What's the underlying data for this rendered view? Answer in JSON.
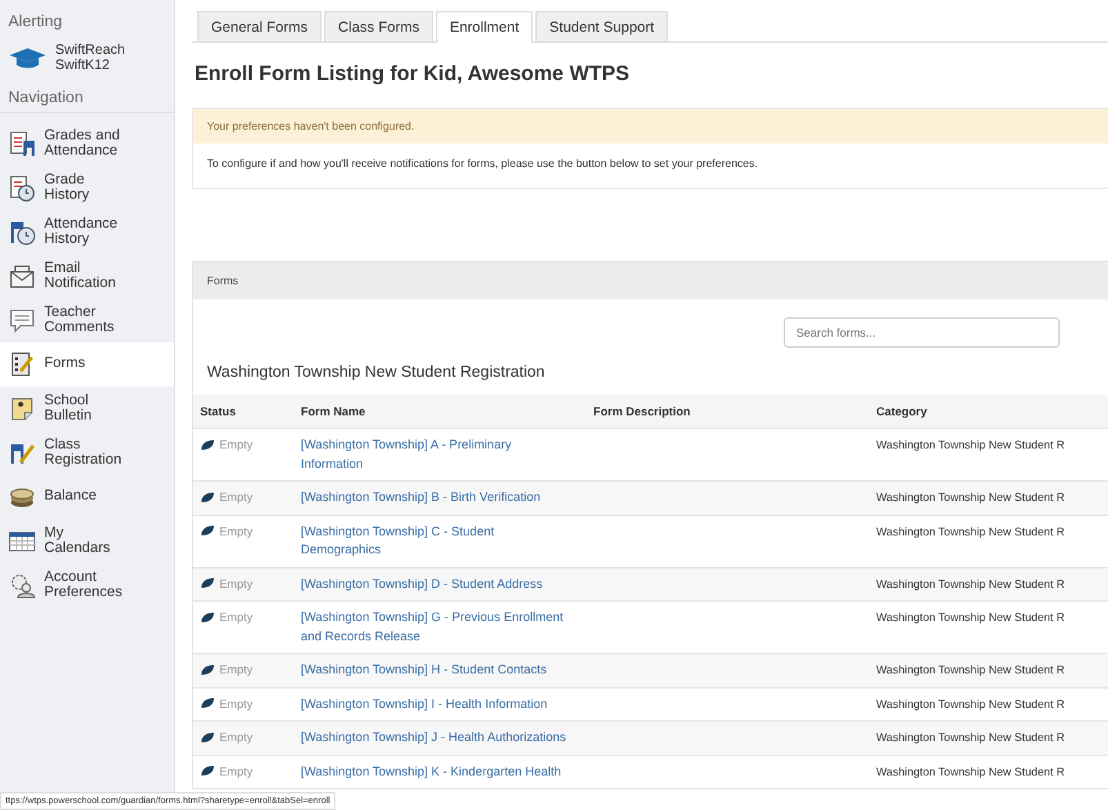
{
  "sidebar": {
    "alerting_heading": "Alerting",
    "alert_app": {
      "label": "SwiftReach\nSwiftK12"
    },
    "navigation_heading": "Navigation",
    "items": [
      {
        "label": "Grades and\nAttendance",
        "selected": false
      },
      {
        "label": "Grade\nHistory",
        "selected": false
      },
      {
        "label": "Attendance\nHistory",
        "selected": false
      },
      {
        "label": "Email\nNotification",
        "selected": false
      },
      {
        "label": "Teacher\nComments",
        "selected": false
      },
      {
        "label": "Forms",
        "selected": true
      },
      {
        "label": "School\nBulletin",
        "selected": false
      },
      {
        "label": "Class\nRegistration",
        "selected": false
      },
      {
        "label": "Balance",
        "selected": false
      },
      {
        "label": "My\nCalendars",
        "selected": false
      },
      {
        "label": "Account\nPreferences",
        "selected": false
      }
    ]
  },
  "tabs": [
    {
      "label": "General Forms",
      "selected": false
    },
    {
      "label": "Class Forms",
      "selected": false
    },
    {
      "label": "Enrollment",
      "selected": true
    },
    {
      "label": "Student Support",
      "selected": false
    }
  ],
  "page_title": "Enroll Form Listing for Kid, Awesome WTPS",
  "notice": {
    "warning": "Your preferences haven't been configured.",
    "message": "To configure if and how you'll receive notifications for forms, please use the button below to set your preferences."
  },
  "forms_panel": {
    "title": "Forms",
    "search": {
      "placeholder": "Search forms..."
    },
    "group_title": "Washington Township New Student Registration",
    "table": {
      "columns": [
        "Status",
        "Form Name",
        "Form Description",
        "Category"
      ],
      "rows": [
        {
          "status": "Empty",
          "form_name": "[Washington Township] A - Preliminary Information",
          "category": "Washington Township New Student R"
        },
        {
          "status": "Empty",
          "form_name": "[Washington Township] B - Birth Verification",
          "category": "Washington Township New Student R"
        },
        {
          "status": "Empty",
          "form_name": "[Washington Township] C - Student Demographics",
          "category": "Washington Township New Student R"
        },
        {
          "status": "Empty",
          "form_name": "[Washington Township] D - Student Address",
          "category": "Washington Township New Student R"
        },
        {
          "status": "Empty",
          "form_name": "[Washington Township] G - Previous Enrollment and Records Release",
          "category": "Washington Township New Student R"
        },
        {
          "status": "Empty",
          "form_name": "[Washington Township] H - Student Contacts",
          "category": "Washington Township New Student R"
        },
        {
          "status": "Empty",
          "form_name": "[Washington Township] I - Health Information",
          "category": "Washington Township New Student R"
        },
        {
          "status": "Empty",
          "form_name": "[Washington Township] J - Health Authorizations",
          "category": "Washington Township New Student R"
        },
        {
          "status": "Empty",
          "form_name": "[Washington Township] K - Kindergarten Health",
          "category": "Washington Township New Student R"
        }
      ]
    }
  },
  "status_url": "ttps://wtps.powerschool.com/guardian/forms.html?sharetype=enroll&tabSel=enroll"
}
